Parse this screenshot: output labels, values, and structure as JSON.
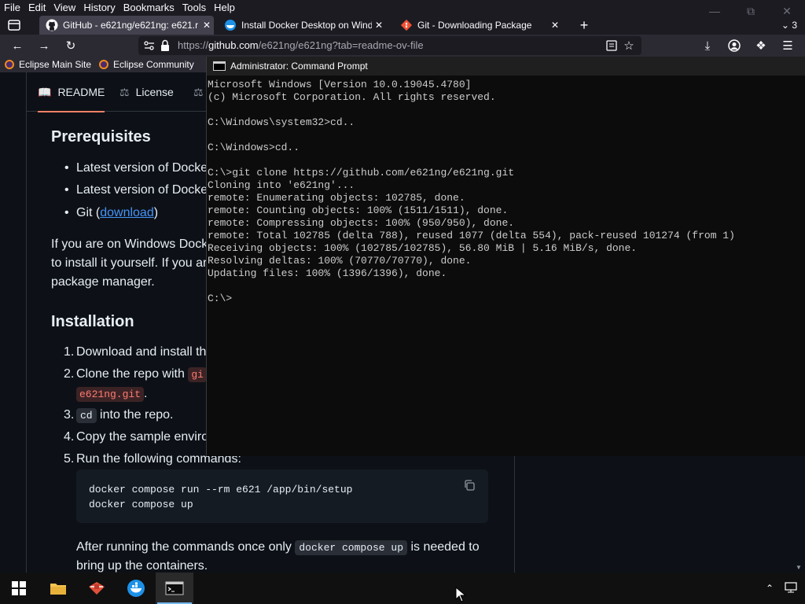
{
  "menubar": {
    "items": [
      "File",
      "Edit",
      "View",
      "History",
      "Bookmarks",
      "Tools",
      "Help"
    ]
  },
  "tabs": [
    {
      "label": "GitHub - e621ng/e621ng: e621.r",
      "icon": "github-icon",
      "active": true
    },
    {
      "label": "Install Docker Desktop on Wind",
      "icon": "docker-icon",
      "active": false
    },
    {
      "label": "Git - Downloading Package",
      "icon": "git-icon",
      "active": false
    }
  ],
  "tab_overflow": "3",
  "nav": {
    "url_prefix": "https://",
    "url_host": "github.com",
    "url_path": "/e621ng/e621ng?tab=readme-ov-file"
  },
  "bookmarks": [
    "Eclipse Main Site",
    "Eclipse Community"
  ],
  "readme": {
    "tabs": [
      "README",
      "License"
    ],
    "prereq_heading": "Prerequisites",
    "prereq_items": [
      "Latest version of Docke",
      "Latest version of Docke"
    ],
    "git_prefix": "Git (",
    "git_link": "download",
    "git_suffix": ")",
    "para_lines": [
      "If you are on Windows Dock",
      "to install it yourself. If you ar",
      "package manager."
    ],
    "install_heading": "Installation",
    "steps": {
      "s1": "Download and install th",
      "s2_text": "Clone the repo with ",
      "s2_code": "gi",
      "s2_cont_code": "e621ng.git",
      "s2_cont_text": ".",
      "s3_code": "cd",
      "s3_text": " into the repo.",
      "s4": "Copy the sample enviro",
      "s5": "Run the following commands:"
    },
    "numbers": [
      "1.",
      "2.",
      "3.",
      "4.",
      "5."
    ],
    "code_lines": [
      "docker compose run --rm e621 /app/bin/setup",
      "docker compose up"
    ],
    "after_pre": "After running the commands once only ",
    "after_code": "docker compose up",
    "after_post": " is needed to",
    "after_line2": "bring up the containers."
  },
  "cmd": {
    "title": "Administrator: Command Prompt",
    "lines": [
      "Microsoft Windows [Version 10.0.19045.4780]",
      "(c) Microsoft Corporation. All rights reserved.",
      "",
      "C:\\Windows\\system32>cd..",
      "",
      "C:\\Windows>cd..",
      "",
      "C:\\>git clone https://github.com/e621ng/e621ng.git",
      "Cloning into 'e621ng'...",
      "remote: Enumerating objects: 102785, done.",
      "remote: Counting objects: 100% (1511/1511), done.",
      "remote: Compressing objects: 100% (950/950), done.",
      "remote: Total 102785 (delta 788), reused 1077 (delta 554), pack-reused 101274 (from 1)",
      "Receiving objects: 100% (102785/102785), 56.80 MiB | 5.16 MiB/s, done.",
      "Resolving deltas: 100% (70770/70770), done.",
      "Updating files: 100% (1396/1396), done.",
      "",
      "C:\\>"
    ]
  },
  "colors": {
    "accent_tab": "#f78166",
    "link": "#4493f8",
    "code_red": "#ff7b72"
  }
}
